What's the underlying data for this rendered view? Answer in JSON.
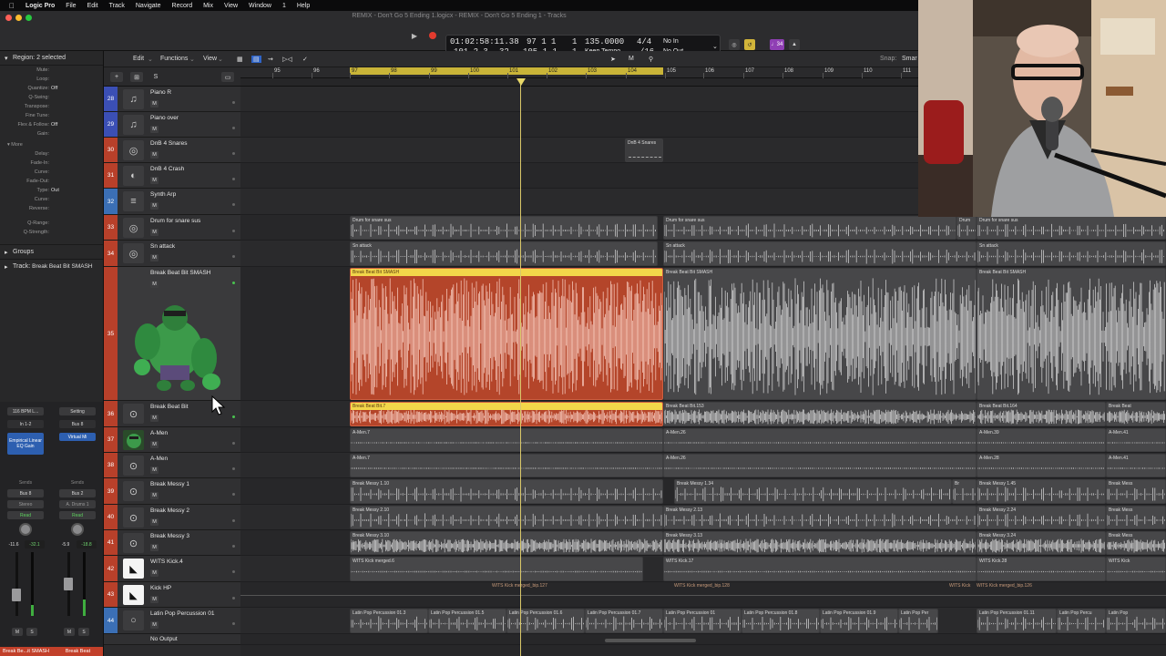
{
  "menubar": {
    "app": "Logic Pro",
    "items": [
      "File",
      "Edit",
      "Track",
      "Navigate",
      "Record",
      "Mix",
      "View",
      "Window",
      "1",
      "Help"
    ]
  },
  "window_title": "REMIX - Don't Go 5 Ending 1.logicx - REMIX - Don't Go 5 Ending 1 - Tracks",
  "lcd": {
    "smpte": "01:02:58:11.38",
    "bars_top": "97  1  1",
    "bars_top_last": "1",
    "bars_bottom": "101  2  3",
    "bars_bottom_sub": "32",
    "end_bars": "105  1  1",
    "end_last": "1",
    "tempo": "135.0000",
    "tempo_mode": "Keep Tempo",
    "signature": "4/4",
    "division": "/16",
    "input": "No In",
    "output": "No Out"
  },
  "right_badge": "♩34",
  "inspector": {
    "region_label": "Region: 2 selected",
    "params": [
      {
        "label": "Mute:",
        "value": ""
      },
      {
        "label": "Loop:",
        "value": ""
      },
      {
        "label": "Quantize:",
        "value": "Off"
      },
      {
        "label": "Q-Swing:",
        "value": ""
      },
      {
        "label": "Transpose:",
        "value": ""
      },
      {
        "label": "Fine Tune:",
        "value": ""
      },
      {
        "label": "Flex & Follow:",
        "value": "Off"
      },
      {
        "label": "Gain:",
        "value": ""
      }
    ],
    "more_label": "More",
    "params2": [
      {
        "label": "Delay:",
        "value": ""
      },
      {
        "label": "Fade-In:",
        "value": ""
      },
      {
        "label": "Curve:",
        "value": ""
      },
      {
        "label": "Fade-Out:",
        "value": ""
      },
      {
        "label": "Type:",
        "value": "Out"
      },
      {
        "label": "Curve:",
        "value": ""
      },
      {
        "label": "Reverse:",
        "value": ""
      }
    ],
    "params3": [
      {
        "label": "Q-Range:",
        "value": ""
      },
      {
        "label": "Q-Strength:",
        "value": ""
      }
    ],
    "groups_label": "Groups",
    "track_label": "Track:",
    "track_value": "Break Beat Bit SMASH"
  },
  "channel_strips": [
    {
      "setting": "116 BPM L...",
      "input": "In 1-2",
      "plugin": "Empirical Linear EQ Gain",
      "sends": "Sends",
      "bus": "Bus 8",
      "stereo": "Stereo",
      "mode": "Read",
      "vol": "-11.6",
      "peak": "-32.1",
      "name": "Break Be...it SMASH",
      "color": "#c2402a"
    },
    {
      "setting": "Setting",
      "input": "Bus 8",
      "plugin": "Virtual Mi",
      "sends": "Sends",
      "bus": "Bus 2",
      "stereo": "A. Drums 1",
      "mode": "Read",
      "vol": "-5.9",
      "peak": "-18.8",
      "name": "Break Beat",
      "color": "#c2402a"
    }
  ],
  "strip_buttons": {
    "mute": "M",
    "solo": "S"
  },
  "track_toolbar": {
    "edit": "Edit",
    "functions": "Functions",
    "view": "View",
    "snap_label": "Snap:",
    "snap_value": "Smar"
  },
  "header_buttons": {
    "add": "+",
    "folder": "⊞",
    "solo": "S"
  },
  "ruler": {
    "bars": [
      "95",
      "96",
      "97",
      "98",
      "99",
      "100",
      "101",
      "102",
      "103",
      "104",
      "105",
      "106",
      "107",
      "108",
      "109",
      "110",
      "111"
    ]
  },
  "tracks": [
    {
      "num": "28",
      "name": "Piano R",
      "icon": "piano-icon",
      "glyph": "♫",
      "color": "#3b4fb5"
    },
    {
      "num": "29",
      "name": "Piano over",
      "icon": "piano-icon",
      "glyph": "♫",
      "color": "#3b4fb5"
    },
    {
      "num": "30",
      "name": "DnB 4 Snares",
      "icon": "snare-drum-icon",
      "glyph": "◎",
      "color": "#b8402a"
    },
    {
      "num": "31",
      "name": "DnB 4 Crash",
      "icon": "cymbal-icon",
      "glyph": "◐",
      "color": "#b8402a"
    },
    {
      "num": "32",
      "name": "Synth Arp",
      "icon": "synth-icon",
      "glyph": "≡",
      "color": "#3b6fb5"
    },
    {
      "num": "33",
      "name": "Drum for snare sus",
      "icon": "snare-drum-icon",
      "glyph": "◎",
      "color": "#b8402a"
    },
    {
      "num": "34",
      "name": "Sn attack",
      "icon": "snare-drum-icon",
      "glyph": "◎",
      "color": "#b8402a"
    },
    {
      "num": "35",
      "name": "Break Beat Bit SMASH",
      "icon": "hulk-image-icon",
      "glyph": "",
      "color": "#b8402a"
    },
    {
      "num": "36",
      "name": "Break Beat Bit",
      "icon": "drum-kit-icon",
      "glyph": "⊙",
      "color": "#b8402a"
    },
    {
      "num": "37",
      "name": "A-Men",
      "icon": "hulk-image-icon",
      "glyph": "",
      "color": "#b8402a"
    },
    {
      "num": "38",
      "name": "A-Men",
      "icon": "drum-kit-icon",
      "glyph": "⊙",
      "color": "#b8402a"
    },
    {
      "num": "39",
      "name": "Break Messy 1",
      "icon": "drum-kit-icon",
      "glyph": "⊙",
      "color": "#b8402a"
    },
    {
      "num": "40",
      "name": "Break Messy 2",
      "icon": "drum-kit-icon",
      "glyph": "⊙",
      "color": "#b8402a"
    },
    {
      "num": "41",
      "name": "Break Messy 3",
      "icon": "drum-kit-icon",
      "glyph": "⊙",
      "color": "#b8402a"
    },
    {
      "num": "42",
      "name": "WITS Kick.4",
      "icon": "kick-icon",
      "glyph": "◣",
      "color": "#b8402a"
    },
    {
      "num": "43",
      "name": "Kick HP",
      "icon": "kick-icon",
      "glyph": "◣",
      "color": "#b8402a"
    },
    {
      "num": "44",
      "name": "Latin Pop Percussion 01",
      "icon": "tambourine-icon",
      "glyph": "○",
      "color": "#3b6fb5"
    },
    {
      "num": "",
      "name": "No Output",
      "icon": "",
      "glyph": "",
      "color": "#3b6fb5"
    }
  ],
  "mute_label": "M",
  "regions": {
    "dnb4snares": "DnB 4 Snares",
    "drumsnare": "Drum for snare sus",
    "drumsnare_short": "Drum",
    "snattack": "Sn attack",
    "bbsmash_sel": "Break Beat Bit SMASH",
    "bbsmash": "Break Beat Bit SMASH",
    "bb7": "Break Beat Bit.7",
    "bb153": "Break Beat Bit.153",
    "bb164": "Break Beat Bit.164",
    "bbr": "Break Beat",
    "amen7": "A-Men.7",
    "amen26": "A-Men.26",
    "amen39": "A-Men.39",
    "amen41": "A-Men.41",
    "amen28": "A-Men.28",
    "bm110": "Break Messy 1.10",
    "bm134": "Break Messy 1.34",
    "bm145": "Break Messy 1.45",
    "bm1x": "Break Mess",
    "bm1s": "Br",
    "bm210": "Break Messy 2.10",
    "bm213": "Break Messy 2.13",
    "bm224": "Break Messy 2.24",
    "bm2x": "Break Mess",
    "bm310": "Break Messy 3.10",
    "bm313": "Break Messy 3.13",
    "bm324": "Break Messy 3.24",
    "bm3x": "Break Mess",
    "wk6": "WITS Kick merged.6",
    "wk17": "WITS Kick.17",
    "wk28": "WITS Kick.28",
    "wkx": "WITS Kick",
    "wkb127": "WITS Kick merged_bip.127",
    "wkb128": "WITS Kick merged_bip.128",
    "wkb126": "WITS Kick merged_bip.126",
    "wks": "WITS Kick",
    "lp013": "Latin Pop Percussion 01.3",
    "lp015": "Latin Pop Percussion 01.5",
    "lp016": "Latin Pop Percussion 01.6",
    "lp017": "Latin Pop Percussion 01.7",
    "lp01": "Latin Pop Percussion 01",
    "lp018": "Latin Pop Percussion 01.8",
    "lp019": "Latin Pop Percussion 01.9",
    "lpx": "Latin Pop Per",
    "lp0111": "Latin Pop Percussion 01.11",
    "lpp": "Latin Pop Percu",
    "lpl": "Latin Pop"
  },
  "colors": {
    "region_red": "#b4452a",
    "selection_yellow": "#f2d64a",
    "cycle": "#c9b438"
  }
}
